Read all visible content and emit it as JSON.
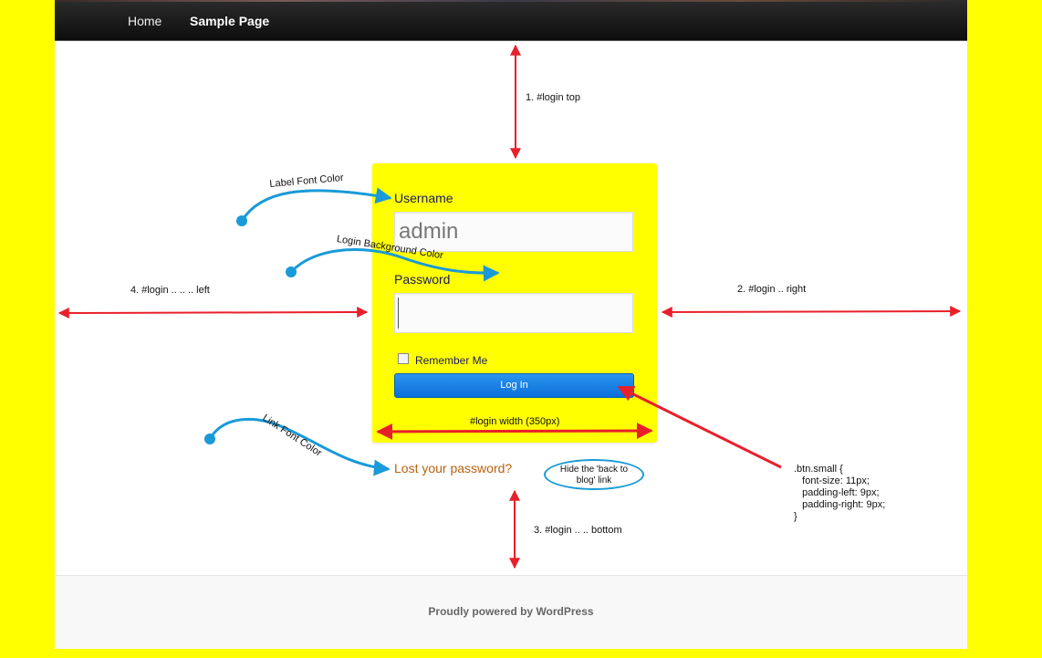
{
  "nav": {
    "items": [
      {
        "label": "Home"
      },
      {
        "label": "Sample Page"
      }
    ]
  },
  "login": {
    "username_label": "Username",
    "username_value": "admin",
    "password_label": "Password",
    "password_value": "",
    "remember_label": "Remember Me",
    "remember_checked": false,
    "button_label": "Log In",
    "lost_password_link": "Lost your password?"
  },
  "footer": {
    "text": "Proudly powered by WordPress"
  },
  "annotations": {
    "top": "1. #login top",
    "right": "2. #login .. right",
    "bottom": "3. #login .. .. bottom",
    "left": "4. #login .. .. .. left",
    "width": "#login width (350px)",
    "label_font_color": "Label Font Color",
    "login_background_color": "Login Background Color",
    "link_font_color": "Link Font Color",
    "hide_back_line1": "Hide the 'back to",
    "hide_back_line2": "blog' link",
    "css_snippet": ".btn.small {\n   font-size: 11px;\n   padding-left: 9px;\n   padding-right: 9px;\n}"
  },
  "colors": {
    "background": "#ffff00",
    "navbar": "#111111",
    "button": "#1a82e6",
    "link": "#b8620f",
    "red_arrow": "#e8202a",
    "blue_arrow": "#1a9ad8"
  }
}
